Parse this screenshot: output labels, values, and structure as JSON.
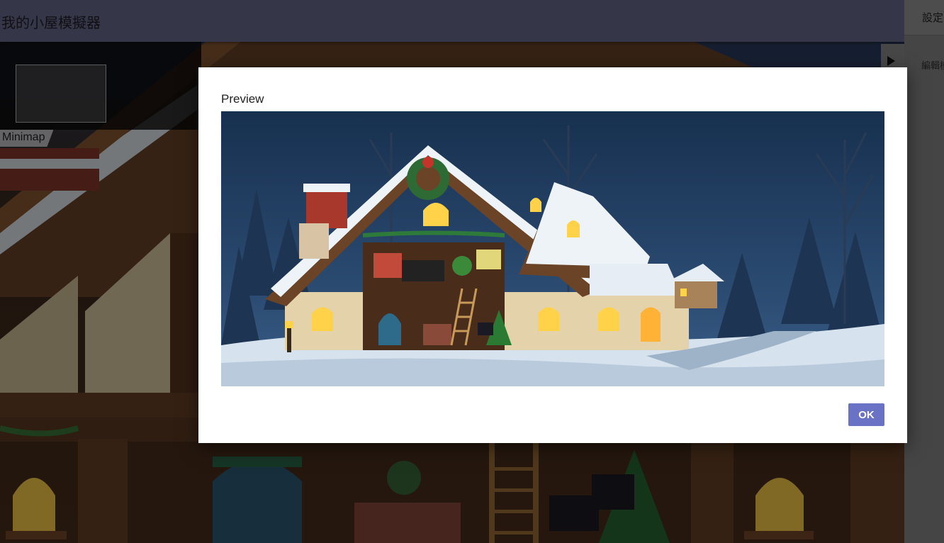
{
  "header": {
    "title": "我的小屋模擬器"
  },
  "side_panel": {
    "heading": "設定",
    "subheading": "編輯模",
    "toggle_icon": "play-triangle-icon"
  },
  "minimap": {
    "label": "Minimap"
  },
  "modal": {
    "title": "Preview",
    "ok_label": "OK"
  },
  "colors": {
    "header_bg": "#6b6e91",
    "ok_button": "#6a72c6",
    "side_panel": "#8a8a8a"
  }
}
